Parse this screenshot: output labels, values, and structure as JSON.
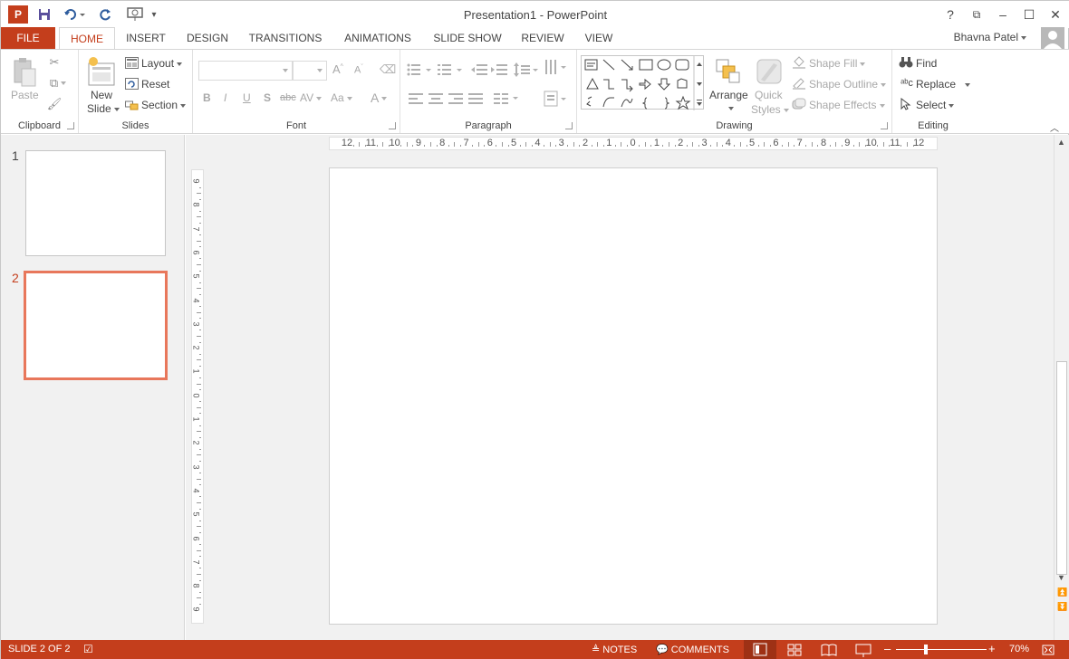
{
  "window": {
    "title": "Presentation1 - PowerPoint",
    "help": "?",
    "ribbon_display": "⧉",
    "minimize": "–",
    "maximize": "☐",
    "close": "✕"
  },
  "qat": {
    "app_icon": "P",
    "save_icon": "floppy-icon",
    "undo_icon": "undo-icon",
    "redo_icon": "redo-icon",
    "present_icon": "present-icon"
  },
  "tabs": [
    {
      "label": "FILE"
    },
    {
      "label": "HOME"
    },
    {
      "label": "INSERT"
    },
    {
      "label": "DESIGN"
    },
    {
      "label": "TRANSITIONS"
    },
    {
      "label": "ANIMATIONS"
    },
    {
      "label": "SLIDE SHOW"
    },
    {
      "label": "REVIEW"
    },
    {
      "label": "VIEW"
    }
  ],
  "user": {
    "name": "Bhavna Patel"
  },
  "ribbon": {
    "clipboard": {
      "label": "Clipboard",
      "paste": "Paste"
    },
    "slides": {
      "label": "Slides",
      "new_slide_1": "New",
      "new_slide_2": "Slide",
      "layout": "Layout",
      "reset": "Reset",
      "section": "Section"
    },
    "font": {
      "label": "Font",
      "bold": "B",
      "italic": "I",
      "underline": "U",
      "shadow": "S",
      "strike": "abc",
      "spacing": "AV",
      "case": "Aa",
      "color": "A",
      "grow": "A",
      "shrink": "A"
    },
    "paragraph": {
      "label": "Paragraph"
    },
    "drawing": {
      "label": "Drawing",
      "arrange": "Arrange",
      "quick_styles_1": "Quick",
      "quick_styles_2": "Styles",
      "shape_fill": "Shape Fill",
      "shape_outline": "Shape Outline",
      "shape_effects": "Shape Effects"
    },
    "editing": {
      "label": "Editing",
      "find": "Find",
      "replace": "Replace",
      "select": "Select"
    }
  },
  "slides_pane": {
    "items": [
      {
        "number": "1"
      },
      {
        "number": "2"
      }
    ],
    "selected": 2
  },
  "rulers": {
    "horizontal": [
      "12",
      "11",
      "10",
      "9",
      "8",
      "7",
      "6",
      "5",
      "4",
      "3",
      "2",
      "1",
      "0",
      "1",
      "2",
      "3",
      "4",
      "5",
      "6",
      "7",
      "8",
      "9",
      "10",
      "11",
      "12"
    ],
    "vertical": [
      "9",
      "8",
      "7",
      "6",
      "5",
      "4",
      "3",
      "2",
      "1",
      "0",
      "1",
      "2",
      "3",
      "4",
      "5",
      "6",
      "7",
      "8",
      "9"
    ]
  },
  "status": {
    "slide": "SLIDE 2 OF 2",
    "notes": "NOTES",
    "comments": "COMMENTS",
    "zoom": "70%"
  },
  "colors": {
    "accent": "#c43e1c",
    "selected_thumb": "#e8775b",
    "ribbon_bg": "#ffffff",
    "pane_bg": "#f1f1f1"
  }
}
